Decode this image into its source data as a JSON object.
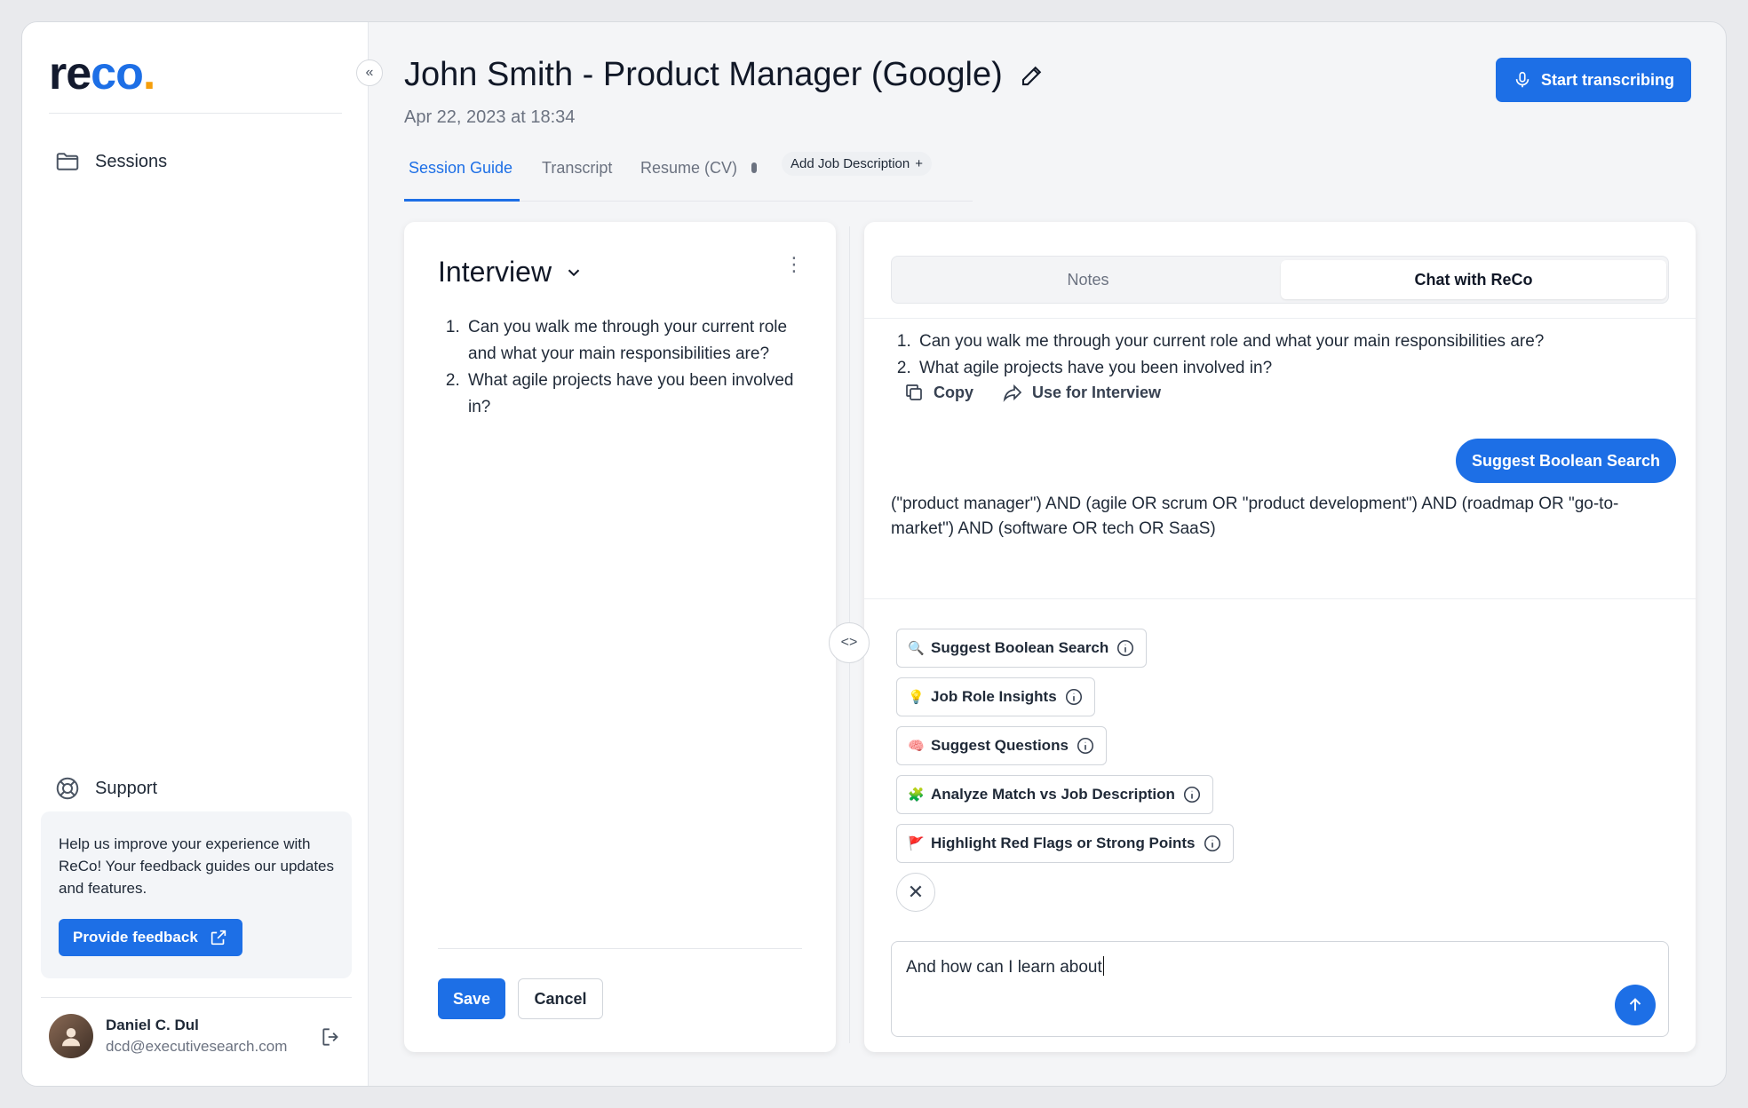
{
  "sidebar": {
    "logo_main": "re",
    "logo_accent": "co",
    "logo_dot": ".",
    "collapse_glyph": "«",
    "nav": [
      {
        "label": "Sessions",
        "icon": "folder-icon"
      }
    ],
    "support_label": "Support",
    "feedback_text": "Help us improve your experience with ReCo! Your feedback guides our updates and features.",
    "feedback_button": "Provide feedback",
    "user": {
      "name": "Daniel C. Dul",
      "email": "dcd@executivesearch.com"
    }
  },
  "header": {
    "title": "John Smith - Product Manager (Google)",
    "date": "Apr 22, 2023 at 18:34",
    "transcribe_button": "Start transcribing"
  },
  "tabs": {
    "session_guide": "Session Guide",
    "transcript": "Transcript",
    "resume": "Resume (CV)",
    "add_jd": "Add Job Description",
    "add_jd_plus": "+"
  },
  "left_panel": {
    "title": "Interview",
    "questions": [
      "Can you walk me through your current role and what your main responsibilities are?",
      "What agile projects have you been involved in?"
    ],
    "save_button": "Save",
    "cancel_button": "Cancel"
  },
  "splitter_glyph": "<>",
  "right_panel": {
    "tabs": {
      "notes": "Notes",
      "chat": "Chat with ReCo"
    },
    "answer": [
      "Can you walk me through your current role and what your main responsibilities are?",
      "What agile projects have you been involved in?"
    ],
    "copy_label": "Copy",
    "use_label": "Use for Interview",
    "user_bubble": "Suggest Boolean Search",
    "boolean_text": "(\"product manager\") AND (agile OR scrum OR \"product development\") AND (roadmap OR \"go-to-market\") AND (software OR tech OR SaaS)",
    "chips": [
      {
        "emoji": "🔍",
        "label": "Suggest Boolean Search"
      },
      {
        "emoji": "💡",
        "label": "Job Role Insights"
      },
      {
        "emoji": "🧠",
        "label": "Suggest Questions"
      },
      {
        "emoji": "🧩",
        "label": "Analyze Match vs Job Description"
      },
      {
        "emoji": "🚩",
        "label": "Highlight Red Flags or Strong Points"
      }
    ],
    "close_glyph": "✕",
    "input_value": "And how can I learn about"
  },
  "colors": {
    "accent": "#1d6fe6",
    "logo_dot": "#f59e0b"
  }
}
